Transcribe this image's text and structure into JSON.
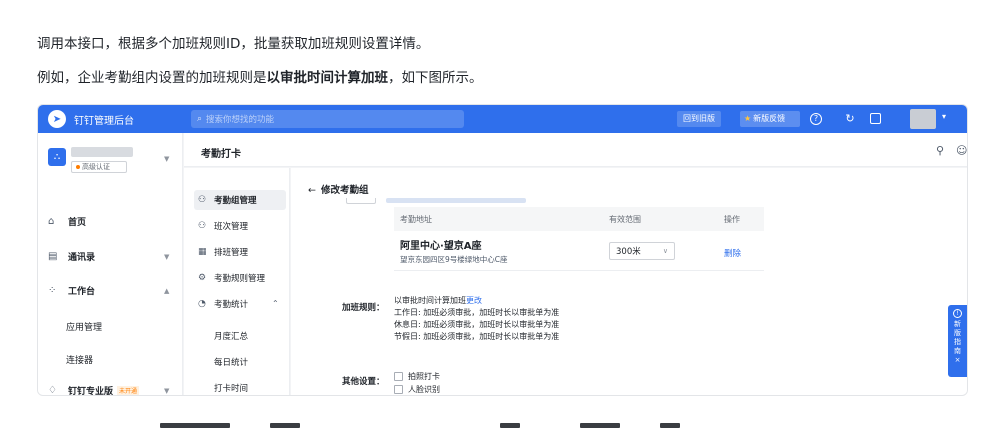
{
  "doc": {
    "line1": "调用本接口，根据多个加班规则ID，批量获取加班规则设置详情。",
    "line2_prefix": "例如，企业考勤组内设置的加班规则是",
    "line2_bold": "以审批时间计算加班",
    "line2_suffix": "，如下图所示。"
  },
  "topbar": {
    "app_title": "钉钉管理后台",
    "search_placeholder": "搜索你想找的功能",
    "old_version": "回到旧版",
    "feedback": "新版反馈",
    "accent": "#2f6fec"
  },
  "leftnav": {
    "org_badge": "高级认证",
    "items": [
      {
        "label": "首页",
        "icon": "home-icon"
      },
      {
        "label": "通讯录",
        "icon": "contacts-icon"
      },
      {
        "label": "工作台",
        "icon": "workbench-icon"
      }
    ],
    "sub_items": [
      "应用管理",
      "连接器"
    ],
    "pro": {
      "label": "钉钉专业版",
      "tag": "未开通"
    }
  },
  "main": {
    "title": "考勤打卡"
  },
  "subnav": {
    "items": [
      "考勤组管理",
      "班次管理",
      "排班管理",
      "考勤规则管理",
      "考勤统计"
    ],
    "stat_sub": [
      "月度汇总",
      "每日统计",
      "打卡时间"
    ]
  },
  "content": {
    "back_title": "修改考勤组",
    "table": {
      "headers": [
        "考勤地址",
        "有效范围",
        "操作"
      ],
      "rows": [
        {
          "name": "阿里中心·望京A座",
          "address": "望京东园四区9号楼绿地中心C座",
          "range": "300米",
          "action": "删除"
        }
      ]
    },
    "rule_label": "加班规则：",
    "rule_title": "以审批时间计算加班",
    "rule_change": "更改",
    "rule_lines": [
      "工作日: 加班必须审批，加班时长以审批单为准",
      "休息日: 加班必须审批，加班时长以审批单为准",
      "节假日: 加班必须审批，加班时长以审批单为准"
    ],
    "other_label": "其他设置：",
    "other_options": [
      "拍照打卡",
      "人脸识别"
    ]
  },
  "guide": {
    "chars": [
      "新",
      "版",
      "指",
      "南"
    ],
    "close": "×"
  }
}
